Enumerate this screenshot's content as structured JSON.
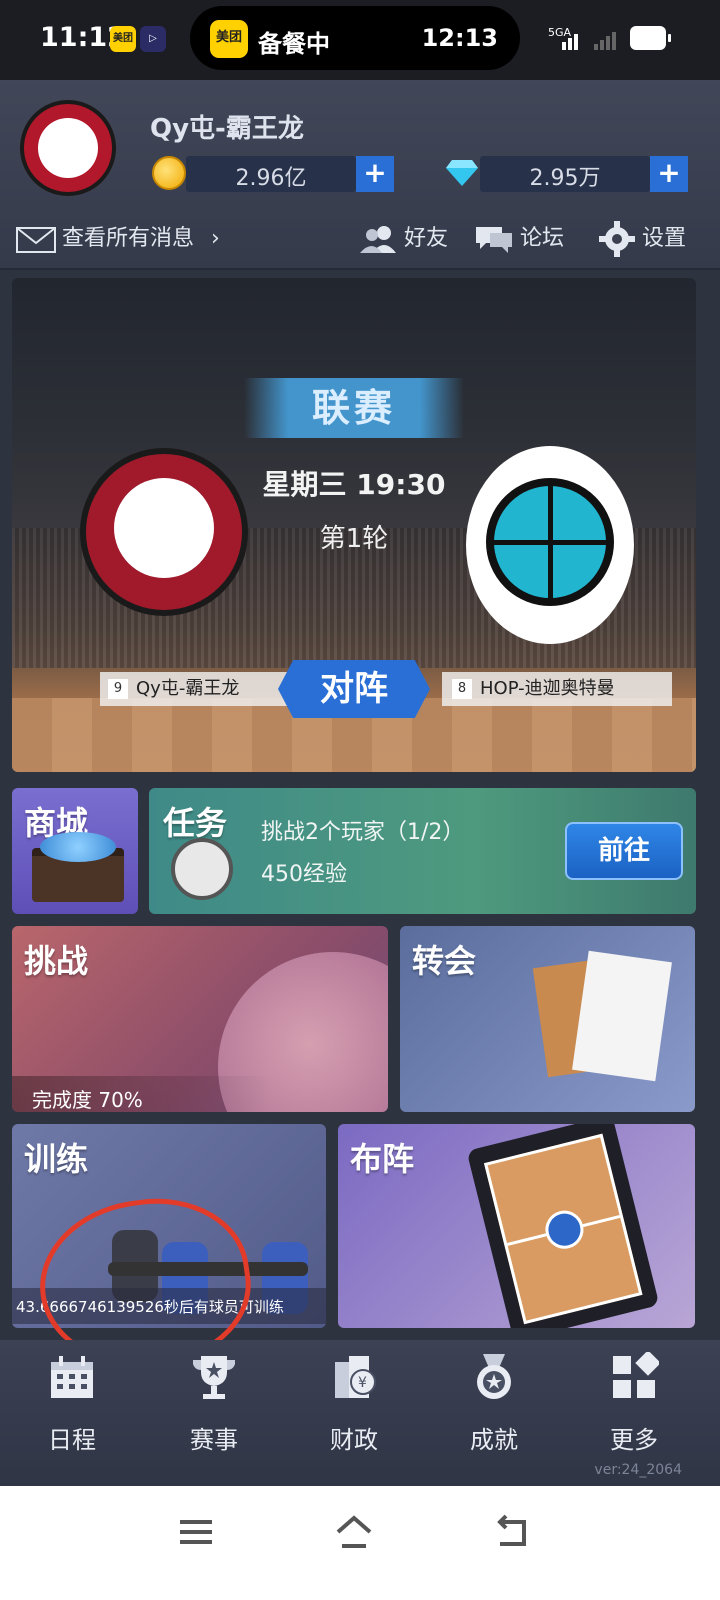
{
  "status_bar": {
    "time": "11:12",
    "mini_app_label": "美团",
    "live_activity_app": "美团",
    "live_activity_text": "备餐中",
    "live_activity_time": "12:13",
    "network": "5GA"
  },
  "header": {
    "username": "Qy屯-霸王龙",
    "coins": "2.96亿",
    "diamonds": "2.95万",
    "add_symbol": "+",
    "messages_link": "查看所有消息",
    "friends": "好友",
    "forum": "论坛",
    "settings": "设置"
  },
  "match": {
    "type": "联赛",
    "time": "星期三 19:30",
    "round": "第1轮",
    "versus": "对阵",
    "home_seed": "9",
    "home_name": "Qy屯-霸王龙",
    "away_seed": "8",
    "away_name": "HOP-迪迦奥特曼"
  },
  "tiles": {
    "shop": "商城",
    "task_title": "任务",
    "task_desc": "挑战2个玩家（1/2）",
    "task_exp": "450经验",
    "task_go": "前往",
    "challenge": "挑战",
    "challenge_progress": "完成度 70%",
    "transfer": "转会",
    "training": "训练",
    "training_status": "43.6666746139526秒后有球员可训练",
    "formation": "布阵"
  },
  "bottom_nav": [
    {
      "label": "日程",
      "icon": "calendar-icon"
    },
    {
      "label": "赛事",
      "icon": "trophy-icon"
    },
    {
      "label": "财政",
      "icon": "finance-icon"
    },
    {
      "label": "成就",
      "icon": "medal-icon"
    },
    {
      "label": "更多",
      "icon": "more-icon"
    }
  ],
  "version": "ver:24_2064",
  "colors": {
    "accent_blue": "#2a6fd6",
    "annotation_red": "#e33b2a",
    "task_green": "#4e9a7e"
  }
}
